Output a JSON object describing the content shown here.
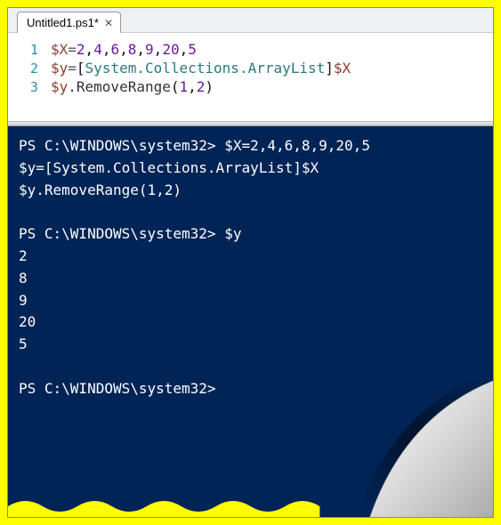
{
  "tab": {
    "title": "Untitled1.ps1*"
  },
  "editor": {
    "lines": [
      {
        "num": "1",
        "tokens": [
          {
            "t": "$X",
            "c": "tok-var"
          },
          {
            "t": "=",
            "c": "tok-op"
          },
          {
            "t": "2",
            "c": "tok-num"
          },
          {
            "t": ",",
            "c": "tok-punc"
          },
          {
            "t": "4",
            "c": "tok-num"
          },
          {
            "t": ",",
            "c": "tok-punc"
          },
          {
            "t": "6",
            "c": "tok-num"
          },
          {
            "t": ",",
            "c": "tok-punc"
          },
          {
            "t": "8",
            "c": "tok-num"
          },
          {
            "t": ",",
            "c": "tok-punc"
          },
          {
            "t": "9",
            "c": "tok-num"
          },
          {
            "t": ",",
            "c": "tok-punc"
          },
          {
            "t": "20",
            "c": "tok-num"
          },
          {
            "t": ",",
            "c": "tok-punc"
          },
          {
            "t": "5",
            "c": "tok-num"
          }
        ]
      },
      {
        "num": "2",
        "tokens": [
          {
            "t": "$y",
            "c": "tok-var"
          },
          {
            "t": "=",
            "c": "tok-op"
          },
          {
            "t": "[",
            "c": "tok-punc"
          },
          {
            "t": "System.Collections.ArrayList",
            "c": "tok-type"
          },
          {
            "t": "]",
            "c": "tok-punc"
          },
          {
            "t": "$X",
            "c": "tok-var"
          }
        ]
      },
      {
        "num": "3",
        "tokens": [
          {
            "t": "$y",
            "c": "tok-var"
          },
          {
            "t": ".RemoveRange",
            "c": "tok-method"
          },
          {
            "t": "(",
            "c": "tok-paren"
          },
          {
            "t": "1",
            "c": "tok-num"
          },
          {
            "t": ",",
            "c": "tok-punc"
          },
          {
            "t": "2",
            "c": "tok-num"
          },
          {
            "t": ")",
            "c": "tok-paren"
          }
        ]
      }
    ]
  },
  "console": {
    "lines": [
      "PS C:\\WINDOWS\\system32> $X=2,4,6,8,9,20,5",
      "$y=[System.Collections.ArrayList]$X",
      "$y.RemoveRange(1,2)",
      "",
      "PS C:\\WINDOWS\\system32> $y",
      "2",
      "8",
      "9",
      "20",
      "5",
      "",
      "PS C:\\WINDOWS\\system32>"
    ]
  }
}
